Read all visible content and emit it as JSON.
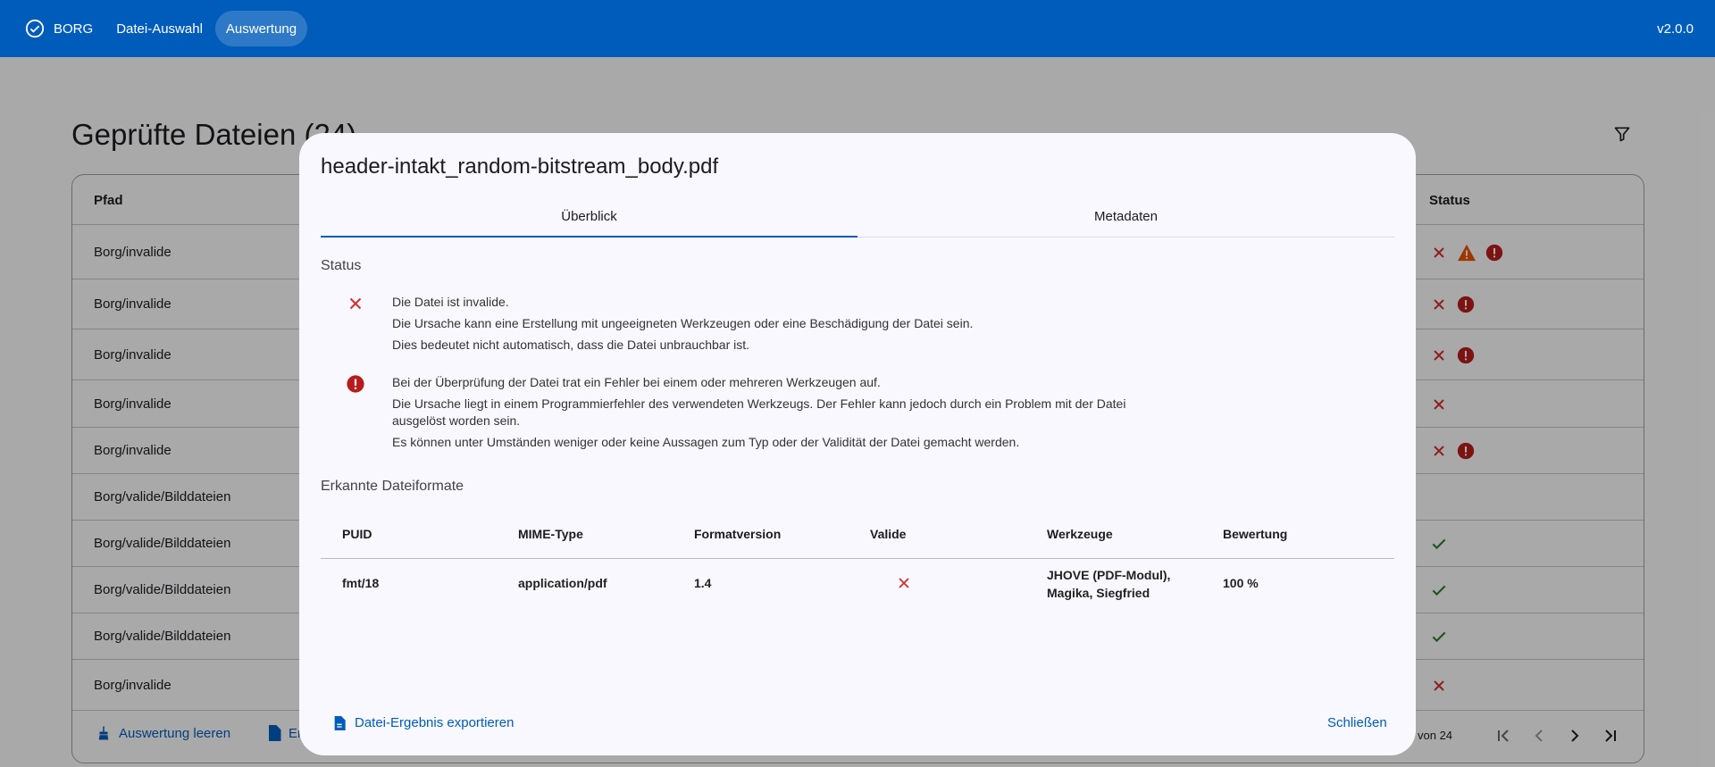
{
  "topbar": {
    "brand": "BORG",
    "nav": [
      "Datei-Auswahl",
      "Auswertung"
    ],
    "active_nav": "Auswertung",
    "version": "v2.0.0"
  },
  "page": {
    "title": "Geprüfte Dateien (24)",
    "columns": {
      "path": "Pfad",
      "status": "Status"
    },
    "rows": [
      {
        "path": "Borg/invalide",
        "status": [
          "invalid",
          "warning",
          "error"
        ]
      },
      {
        "path": "Borg/invalide",
        "status": [
          "invalid",
          "error"
        ]
      },
      {
        "path": "Borg/invalide",
        "status": [
          "invalid",
          "error"
        ]
      },
      {
        "path": "Borg/invalide",
        "status": [
          "invalid"
        ]
      },
      {
        "path": "Borg/invalide",
        "status": [
          "invalid",
          "error"
        ]
      },
      {
        "path": "Borg/valide/Bilddateien",
        "status": []
      },
      {
        "path": "Borg/valide/Bilddateien",
        "status": [
          "valid"
        ]
      },
      {
        "path": "Borg/valide/Bilddateien",
        "status": [
          "valid"
        ]
      },
      {
        "path": "Borg/valide/Bilddateien",
        "status": [
          "valid"
        ]
      },
      {
        "path": "Borg/invalide",
        "status": [
          "invalid"
        ]
      }
    ],
    "footer": {
      "clear_button": "Auswertung leeren",
      "export_button_partial": "Er",
      "pager_text": "von 24"
    }
  },
  "dialog": {
    "title": "header-intakt_random-bitstream_body.pdf",
    "tabs": [
      "Überblick",
      "Metadaten"
    ],
    "active_tab": "Überblick",
    "status_heading": "Status",
    "status_items": [
      {
        "icon": "close-icon",
        "lines": [
          "Die Datei ist invalide.",
          "Die Ursache kann eine Erstellung mit ungeeigneten Werkzeugen oder eine Beschädigung der Datei sein.",
          "Dies bedeutet nicht automatisch, dass die Datei unbrauchbar ist."
        ]
      },
      {
        "icon": "error-icon",
        "lines": [
          "Bei der Überprüfung der Datei trat ein Fehler bei einem oder mehreren Werkzeugen auf.",
          "Die Ursache liegt in einem Programmierfehler des verwendeten Werkzeugs. Der Fehler kann jedoch durch ein Problem mit der Datei ausgelöst worden sein.",
          "Es können unter Umständen weniger oder keine Aussagen zum Typ oder der Validität der Datei gemacht werden."
        ]
      }
    ],
    "formats_heading": "Erkannte Dateiformate",
    "formats_columns": [
      "PUID",
      "MIME-Type",
      "Formatversion",
      "Valide",
      "Werkzeuge",
      "Bewertung"
    ],
    "formats_rows": [
      {
        "puid": "fmt/18",
        "mime": "application/pdf",
        "version": "1.4",
        "valid": false,
        "tools": "JHOVE (PDF-Modul), Magika, Siegfried",
        "score": "100 %"
      }
    ],
    "export_label": "Datei-Ergebnis exportieren",
    "close_label": "Schließen"
  },
  "colors": {
    "primary": "#005cbb",
    "invalid": "#d32f2f",
    "error": "#b71c1c",
    "warning": "#e65100",
    "valid": "#2e7d32"
  }
}
